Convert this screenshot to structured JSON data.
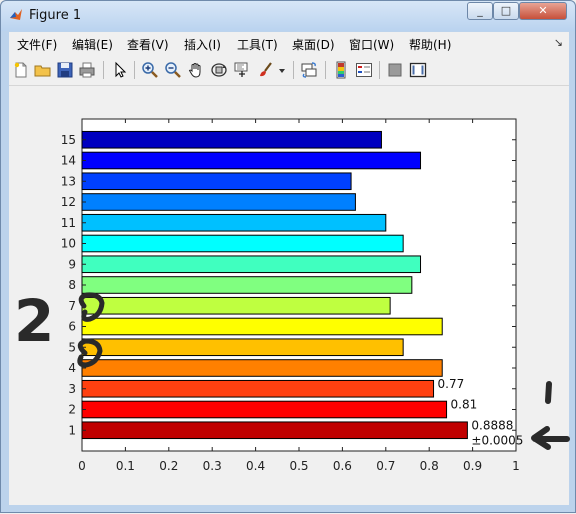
{
  "window": {
    "title": "Figure 1",
    "minimize": "_",
    "maximize": "□",
    "close": "✕"
  },
  "menu": {
    "items": [
      "文件(F)",
      "编辑(E)",
      "查看(V)",
      "插入(I)",
      "工具(T)",
      "桌面(D)",
      "窗口(W)",
      "帮助(H)"
    ],
    "overflow_icon": "dock-arrow-icon"
  },
  "toolbar": {
    "icons": [
      "new-figure-icon",
      "open-file-icon",
      "save-icon",
      "print-icon",
      "edit-plot-arrow-icon",
      "zoom-in-icon",
      "zoom-out-icon",
      "pan-hand-icon",
      "rotate-3d-icon",
      "data-cursor-icon",
      "brush-icon",
      "brush-dropdown-icon",
      "link-plot-icon",
      "colorbar-icon",
      "legend-icon",
      "hide-plot-tools-icon",
      "show-plot-tools-icon"
    ]
  },
  "chart_data": {
    "type": "bar",
    "orientation": "horizontal",
    "categories": [
      "1",
      "2",
      "3",
      "4",
      "5",
      "6",
      "7",
      "8",
      "9",
      "10",
      "11",
      "12",
      "13",
      "14",
      "15"
    ],
    "values": [
      0.888,
      0.84,
      0.81,
      0.83,
      0.74,
      0.83,
      0.71,
      0.76,
      0.78,
      0.74,
      0.7,
      0.63,
      0.62,
      0.78,
      0.69
    ],
    "bar_colors": [
      "#c00000",
      "#ff0000",
      "#ff4010",
      "#ff8000",
      "#ffc000",
      "#ffff00",
      "#bfff40",
      "#80ff80",
      "#40ffbf",
      "#00ffff",
      "#00c0ff",
      "#0080ff",
      "#0040ff",
      "#0000ff",
      "#0000c0"
    ],
    "xlim": [
      0,
      1
    ],
    "xticks": [
      "0",
      "0.1",
      "0.2",
      "0.3",
      "0.4",
      "0.5",
      "0.6",
      "0.7",
      "0.8",
      "0.9",
      "1"
    ],
    "xtick_values": [
      0,
      0.1,
      0.2,
      0.3,
      0.4,
      0.5,
      0.6,
      0.7,
      0.8,
      0.9,
      1
    ],
    "annotations": [
      {
        "bar": "1",
        "text": "0.8888"
      },
      {
        "bar": "1",
        "text": "±0.0005"
      },
      {
        "bar": "2",
        "text": "0.81"
      },
      {
        "bar": "3",
        "text": "0.77"
      }
    ],
    "grid": false
  },
  "handwriting": {
    "left_mark": "2"
  }
}
